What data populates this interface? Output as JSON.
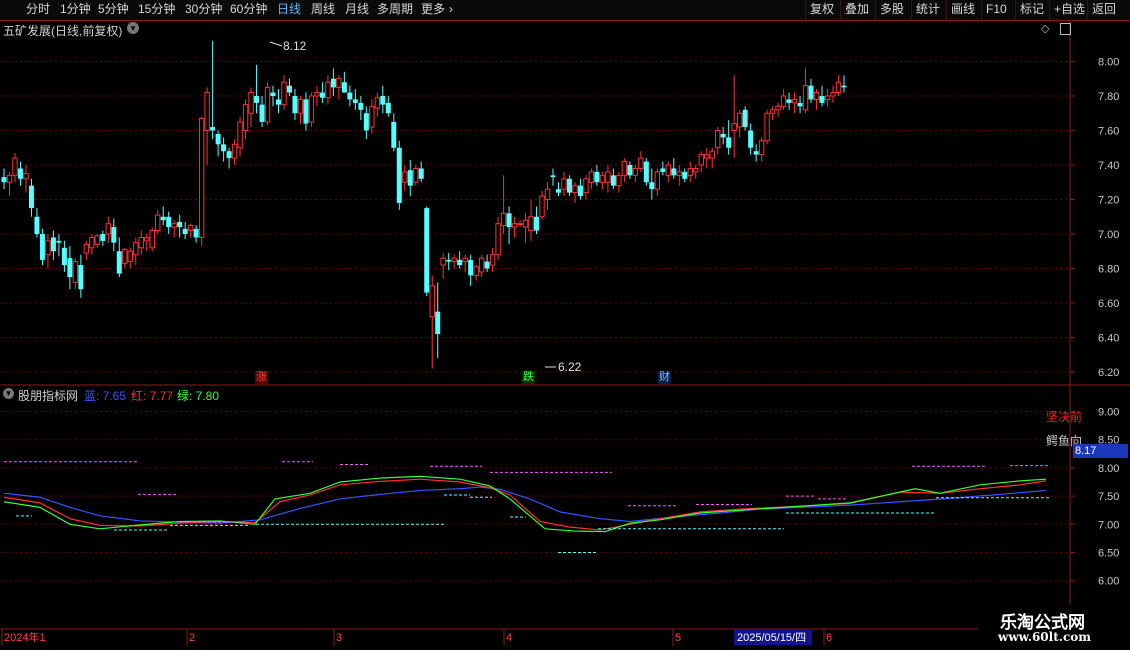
{
  "toolbar": {
    "left": [
      {
        "label": "分时",
        "active": false
      },
      {
        "label": "1分钟",
        "active": false
      },
      {
        "label": "5分钟",
        "active": false
      },
      {
        "label": "15分钟",
        "active": false
      },
      {
        "label": "30分钟",
        "active": false
      },
      {
        "label": "60分钟",
        "active": false
      },
      {
        "label": "日线",
        "active": true
      },
      {
        "label": "周线",
        "active": false
      },
      {
        "label": "月线",
        "active": false
      },
      {
        "label": "多周期",
        "active": false
      },
      {
        "label": "更多",
        "active": false
      }
    ],
    "right": [
      "复权",
      "叠加",
      "多股",
      "统计",
      "画线",
      "F10",
      "标记",
      "+自选",
      "返回"
    ]
  },
  "main": {
    "title": "五矿发展(日线,前复权)",
    "high_label": "8.12",
    "low_label": "6.22",
    "yticks": [
      "8.00",
      "7.80",
      "7.60",
      "7.40",
      "7.20",
      "7.00",
      "6.80",
      "6.60",
      "6.40",
      "6.20"
    ],
    "badges": [
      {
        "text": "涨"
      },
      {
        "text": "跌"
      },
      {
        "text": "财"
      }
    ]
  },
  "indicator": {
    "name": "股朋指标网",
    "values": [
      {
        "label": "蓝: 7.65",
        "color": "#3355ff"
      },
      {
        "label": "红: 7.77",
        "color": "#ff3030"
      },
      {
        "label": "绿: 7.80",
        "color": "#33ff33"
      }
    ],
    "right_text1": "坚决前",
    "right_text2": "鳄鱼向",
    "current_value": "8.17",
    "yticks": [
      "9.00",
      "8.50",
      "8.00",
      "7.50",
      "7.00",
      "6.50",
      "6.00"
    ]
  },
  "date_axis": {
    "labels": [
      "2024年1",
      "2",
      "3",
      "4",
      "5",
      "6"
    ],
    "highlight": "2025/05/15/四"
  },
  "watermark": {
    "line1": "乐淘公式网",
    "line2": "www.60lt.com"
  },
  "colors": {
    "up": "#ff3030",
    "down": "#54ffff",
    "grid": "#6a0000",
    "blue_line": "#3355ff",
    "red_line": "#ff3030",
    "green_line": "#33ff33",
    "magenta_dash": "#ff55ff",
    "cyan_dash": "#54ffff"
  },
  "chart_data": {
    "type": "candlestick",
    "ylim": [
      6.15,
      8.25
    ],
    "ohlc": [
      [
        7.33,
        7.38,
        7.26,
        7.3
      ],
      [
        7.3,
        7.36,
        7.22,
        7.34
      ],
      [
        7.34,
        7.47,
        7.3,
        7.44
      ],
      [
        7.38,
        7.42,
        7.28,
        7.32
      ],
      [
        7.32,
        7.4,
        7.24,
        7.35
      ],
      [
        7.28,
        7.32,
        7.1,
        7.15
      ],
      [
        7.1,
        7.15,
        6.98,
        7.0
      ],
      [
        7.0,
        7.03,
        6.82,
        6.85
      ],
      [
        6.88,
        7.0,
        6.8,
        6.96
      ],
      [
        6.98,
        7.02,
        6.85,
        6.9
      ],
      [
        6.96,
        7.0,
        6.87,
        6.95
      ],
      [
        6.92,
        6.96,
        6.78,
        6.82
      ],
      [
        6.86,
        6.93,
        6.68,
        6.75
      ],
      [
        6.72,
        6.86,
        6.68,
        6.84
      ],
      [
        6.82,
        6.88,
        6.63,
        6.68
      ],
      [
        6.89,
        6.96,
        6.85,
        6.94
      ],
      [
        6.92,
        7.0,
        6.88,
        6.98
      ],
      [
        6.94,
        7.0,
        6.92,
        6.99
      ],
      [
        7.0,
        7.02,
        6.93,
        6.96
      ],
      [
        7.0,
        7.1,
        6.95,
        7.06
      ],
      [
        7.04,
        7.09,
        6.9,
        6.95
      ],
      [
        6.9,
        6.98,
        6.75,
        6.77
      ],
      [
        6.83,
        6.92,
        6.8,
        6.91
      ],
      [
        6.84,
        6.92,
        6.8,
        6.9
      ],
      [
        6.88,
        6.98,
        6.82,
        6.95
      ],
      [
        6.92,
        7.02,
        6.88,
        6.98
      ],
      [
        6.96,
        7.0,
        6.9,
        6.98
      ],
      [
        6.92,
        7.04,
        6.9,
        7.02
      ],
      [
        7.02,
        7.14,
        7.0,
        7.11
      ],
      [
        7.1,
        7.16,
        7.05,
        7.08
      ],
      [
        7.1,
        7.13,
        7.0,
        7.04
      ],
      [
        7.04,
        7.08,
        6.98,
        7.06
      ],
      [
        7.07,
        7.11,
        6.98,
        7.04
      ],
      [
        7.03,
        7.07,
        6.97,
        7.0
      ],
      [
        7.02,
        7.06,
        6.98,
        7.05
      ],
      [
        7.03,
        7.05,
        6.95,
        6.98
      ],
      [
        6.98,
        7.68,
        6.93,
        7.67
      ],
      [
        7.6,
        7.85,
        7.4,
        7.82
      ],
      [
        7.62,
        8.12,
        7.55,
        7.6
      ],
      [
        7.58,
        7.6,
        7.45,
        7.52
      ],
      [
        7.52,
        7.56,
        7.42,
        7.48
      ],
      [
        7.48,
        7.5,
        7.38,
        7.44
      ],
      [
        7.44,
        7.55,
        7.4,
        7.52
      ],
      [
        7.5,
        7.68,
        7.45,
        7.65
      ],
      [
        7.6,
        7.78,
        7.55,
        7.75
      ],
      [
        7.7,
        7.85,
        7.62,
        7.82
      ],
      [
        7.8,
        7.98,
        7.7,
        7.76
      ],
      [
        7.75,
        7.8,
        7.62,
        7.65
      ],
      [
        7.65,
        7.88,
        7.63,
        7.85
      ],
      [
        7.82,
        7.86,
        7.74,
        7.8
      ],
      [
        7.78,
        7.84,
        7.7,
        7.75
      ],
      [
        7.75,
        7.92,
        7.72,
        7.88
      ],
      [
        7.86,
        7.9,
        7.8,
        7.82
      ],
      [
        7.8,
        7.84,
        7.66,
        7.7
      ],
      [
        7.7,
        7.8,
        7.64,
        7.78
      ],
      [
        7.78,
        7.82,
        7.6,
        7.64
      ],
      [
        7.65,
        7.82,
        7.62,
        7.8
      ],
      [
        7.8,
        7.86,
        7.74,
        7.82
      ],
      [
        7.82,
        7.88,
        7.76,
        7.79
      ],
      [
        7.79,
        7.92,
        7.75,
        7.88
      ],
      [
        7.9,
        7.96,
        7.8,
        7.85
      ],
      [
        7.85,
        7.92,
        7.78,
        7.9
      ],
      [
        7.88,
        7.94,
        7.82,
        7.82
      ],
      [
        7.82,
        7.86,
        7.74,
        7.78
      ],
      [
        7.78,
        7.84,
        7.72,
        7.76
      ],
      [
        7.76,
        7.8,
        7.66,
        7.72
      ],
      [
        7.7,
        7.74,
        7.55,
        7.6
      ],
      [
        7.62,
        7.78,
        7.58,
        7.74
      ],
      [
        7.73,
        7.82,
        7.68,
        7.79
      ],
      [
        7.8,
        7.86,
        7.7,
        7.75
      ],
      [
        7.76,
        7.8,
        7.68,
        7.7
      ],
      [
        7.65,
        7.7,
        7.48,
        7.5
      ],
      [
        7.5,
        7.54,
        7.14,
        7.18
      ],
      [
        7.3,
        7.4,
        7.25,
        7.36
      ],
      [
        7.37,
        7.43,
        7.22,
        7.28
      ],
      [
        7.3,
        7.4,
        7.28,
        7.38
      ],
      [
        7.38,
        7.42,
        7.3,
        7.32
      ],
      [
        7.15,
        7.16,
        6.64,
        6.66
      ],
      [
        6.52,
        6.76,
        6.22,
        6.7
      ],
      [
        6.55,
        6.72,
        6.28,
        6.42
      ],
      [
        6.82,
        6.89,
        6.74,
        6.86
      ],
      [
        6.85,
        6.89,
        6.79,
        6.84
      ],
      [
        6.84,
        6.88,
        6.8,
        6.86
      ],
      [
        6.85,
        6.9,
        6.8,
        6.82
      ],
      [
        6.84,
        6.88,
        6.78,
        6.86
      ],
      [
        6.85,
        6.88,
        6.7,
        6.76
      ],
      [
        6.76,
        6.82,
        6.73,
        6.81
      ],
      [
        6.78,
        6.88,
        6.75,
        6.86
      ],
      [
        6.84,
        6.88,
        6.78,
        6.8
      ],
      [
        6.82,
        6.92,
        6.78,
        6.88
      ],
      [
        6.88,
        7.1,
        6.85,
        7.06
      ],
      [
        7.05,
        7.34,
        7.0,
        7.12
      ],
      [
        7.12,
        7.16,
        6.94,
        7.04
      ],
      [
        7.04,
        7.1,
        6.98,
        7.06
      ],
      [
        7.06,
        7.08,
        7.04,
        7.06
      ],
      [
        7.04,
        7.12,
        6.95,
        7.08
      ],
      [
        7.02,
        7.2,
        6.96,
        7.1
      ],
      [
        7.1,
        7.16,
        7.0,
        7.02
      ],
      [
        7.1,
        7.25,
        7.08,
        7.22
      ],
      [
        7.2,
        7.3,
        7.14,
        7.26
      ],
      [
        7.34,
        7.38,
        7.28,
        7.33
      ],
      [
        7.26,
        7.3,
        7.22,
        7.24
      ],
      [
        7.26,
        7.36,
        7.22,
        7.32
      ],
      [
        7.32,
        7.34,
        7.22,
        7.24
      ],
      [
        7.24,
        7.3,
        7.18,
        7.28
      ],
      [
        7.28,
        7.32,
        7.2,
        7.22
      ],
      [
        7.24,
        7.34,
        7.2,
        7.32
      ],
      [
        7.3,
        7.38,
        7.26,
        7.36
      ],
      [
        7.36,
        7.4,
        7.28,
        7.3
      ],
      [
        7.3,
        7.36,
        7.26,
        7.34
      ],
      [
        7.3,
        7.4,
        7.24,
        7.36
      ],
      [
        7.34,
        7.38,
        7.26,
        7.28
      ],
      [
        7.28,
        7.36,
        7.24,
        7.34
      ],
      [
        7.34,
        7.44,
        7.3,
        7.42
      ],
      [
        7.4,
        7.42,
        7.32,
        7.34
      ],
      [
        7.34,
        7.4,
        7.3,
        7.38
      ],
      [
        7.38,
        7.48,
        7.36,
        7.44
      ],
      [
        7.42,
        7.44,
        7.28,
        7.3
      ],
      [
        7.3,
        7.38,
        7.2,
        7.26
      ],
      [
        7.26,
        7.38,
        7.22,
        7.36
      ],
      [
        7.38,
        7.42,
        7.34,
        7.36
      ],
      [
        7.34,
        7.42,
        7.3,
        7.4
      ],
      [
        7.38,
        7.44,
        7.32,
        7.34
      ],
      [
        7.34,
        7.4,
        7.28,
        7.36
      ],
      [
        7.36,
        7.38,
        7.3,
        7.32
      ],
      [
        7.34,
        7.42,
        7.3,
        7.38
      ],
      [
        7.36,
        7.4,
        7.32,
        7.38
      ],
      [
        7.4,
        7.48,
        7.36,
        7.46
      ],
      [
        7.44,
        7.5,
        7.38,
        7.46
      ],
      [
        7.44,
        7.5,
        7.38,
        7.48
      ],
      [
        7.5,
        7.62,
        7.46,
        7.6
      ],
      [
        7.58,
        7.62,
        7.52,
        7.56
      ],
      [
        7.56,
        7.66,
        7.46,
        7.5
      ],
      [
        7.6,
        7.92,
        7.44,
        7.64
      ],
      [
        7.62,
        7.72,
        7.56,
        7.7
      ],
      [
        7.72,
        7.74,
        7.6,
        7.62
      ],
      [
        7.6,
        7.64,
        7.46,
        7.5
      ],
      [
        7.48,
        7.52,
        7.42,
        7.46
      ],
      [
        7.46,
        7.56,
        7.42,
        7.54
      ],
      [
        7.54,
        7.72,
        7.52,
        7.7
      ],
      [
        7.7,
        7.74,
        7.66,
        7.72
      ],
      [
        7.72,
        7.76,
        7.68,
        7.74
      ],
      [
        7.74,
        7.84,
        7.72,
        7.8
      ],
      [
        7.78,
        7.82,
        7.72,
        7.76
      ],
      [
        7.76,
        7.82,
        7.7,
        7.78
      ],
      [
        7.76,
        7.8,
        7.7,
        7.74
      ],
      [
        7.72,
        7.96,
        7.7,
        7.86
      ],
      [
        7.86,
        7.9,
        7.76,
        7.78
      ],
      [
        7.78,
        7.84,
        7.72,
        7.82
      ],
      [
        7.8,
        7.86,
        7.74,
        7.76
      ],
      [
        7.78,
        7.84,
        7.74,
        7.8
      ],
      [
        7.8,
        7.86,
        7.76,
        7.82
      ],
      [
        7.82,
        7.92,
        7.8,
        7.88
      ],
      [
        7.86,
        7.92,
        7.82,
        7.85
      ]
    ]
  }
}
